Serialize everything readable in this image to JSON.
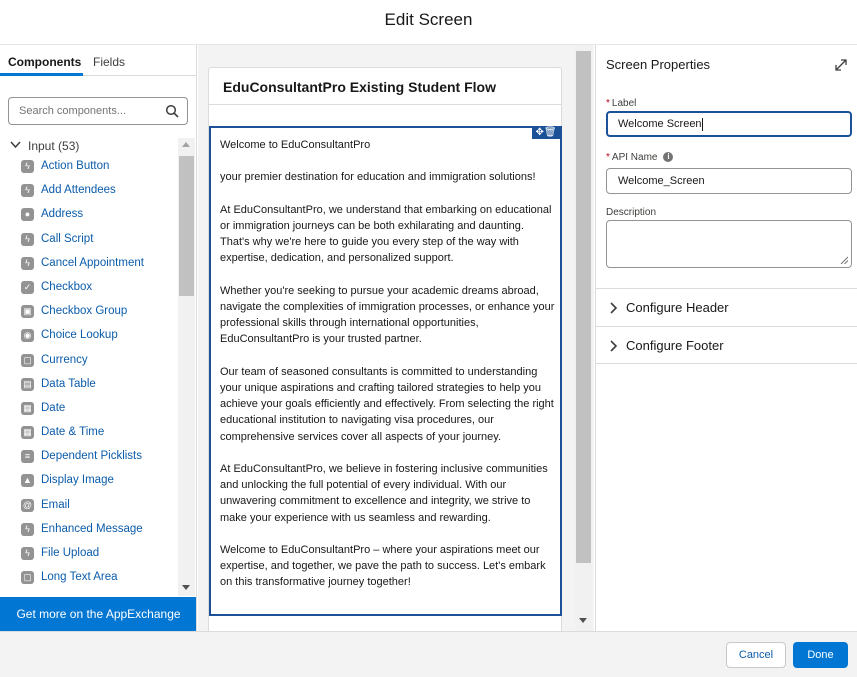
{
  "modal": {
    "title": "Edit Screen"
  },
  "left_panel": {
    "tabs": [
      {
        "label": "Components"
      },
      {
        "label": "Fields"
      }
    ],
    "search_placeholder": "Search components...",
    "group": {
      "label": "Input (53)"
    },
    "items": [
      {
        "label": "Action Button",
        "icon": "bolt-icon"
      },
      {
        "label": "Add Attendees",
        "icon": "bolt-icon"
      },
      {
        "label": "Address",
        "icon": "location-pin-icon"
      },
      {
        "label": "Call Script",
        "icon": "bolt-icon"
      },
      {
        "label": "Cancel Appointment",
        "icon": "bolt-icon"
      },
      {
        "label": "Checkbox",
        "icon": "checkbox-icon"
      },
      {
        "label": "Checkbox Group",
        "icon": "checkbox-group-icon"
      },
      {
        "label": "Choice Lookup",
        "icon": "choice-lookup-icon"
      },
      {
        "label": "Currency",
        "icon": "currency-icon"
      },
      {
        "label": "Data Table",
        "icon": "table-icon"
      },
      {
        "label": "Date",
        "icon": "calendar-icon"
      },
      {
        "label": "Date & Time",
        "icon": "calendar-time-icon"
      },
      {
        "label": "Dependent Picklists",
        "icon": "picklist-icon"
      },
      {
        "label": "Display Image",
        "icon": "image-icon"
      },
      {
        "label": "Email",
        "icon": "email-icon"
      },
      {
        "label": "Enhanced Message",
        "icon": "bolt-icon"
      },
      {
        "label": "File Upload",
        "icon": "bolt-icon"
      },
      {
        "label": "Long Text Area",
        "icon": "long-text-icon"
      }
    ],
    "appexchange_label": "Get more on the AppExchange"
  },
  "canvas": {
    "flow_title": "EduConsultantPro Existing Student Flow",
    "paragraphs": [
      "Welcome to EduConsultantPro",
      "your premier destination for education and immigration solutions!",
      "At EduConsultantPro, we understand that embarking on educational or immigration journeys can be both exhilarating and daunting. That's why we're here to guide you every step of the way with expertise, dedication, and personalized support.",
      "Whether you're seeking to pursue your academic dreams abroad, navigate the complexities of immigration processes, or enhance your professional skills through international opportunities, EduConsultantPro is your trusted partner.",
      "Our team of seasoned consultants is committed to understanding your unique aspirations and crafting tailored strategies to help you achieve your goals efficiently and effectively. From selecting the right educational institution to navigating visa procedures, our comprehensive services cover all aspects of your journey.",
      "At EduConsultantPro, we believe in fostering inclusive communities and unlocking the full potential of every individual. With our unwavering commitment to excellence and integrity, we strive to make your experience with us seamless and rewarding.",
      "Welcome to EduConsultantPro – where your aspirations meet our expertise, and together, we pave the path to success. Let's embark on this transformative journey together!"
    ]
  },
  "properties": {
    "title": "Screen Properties",
    "label_field": {
      "label": "Label",
      "value": "Welcome Screen"
    },
    "api_field": {
      "label": "API Name",
      "value": "Welcome_Screen"
    },
    "description_field": {
      "label": "Description",
      "value": ""
    },
    "sections": [
      {
        "label": "Configure Header"
      },
      {
        "label": "Configure Footer"
      }
    ]
  },
  "footer": {
    "cancel_label": "Cancel",
    "done_label": "Done"
  },
  "colors": {
    "brand": "#0176d3",
    "focus": "#1b5297",
    "link": "#0b5cab"
  }
}
